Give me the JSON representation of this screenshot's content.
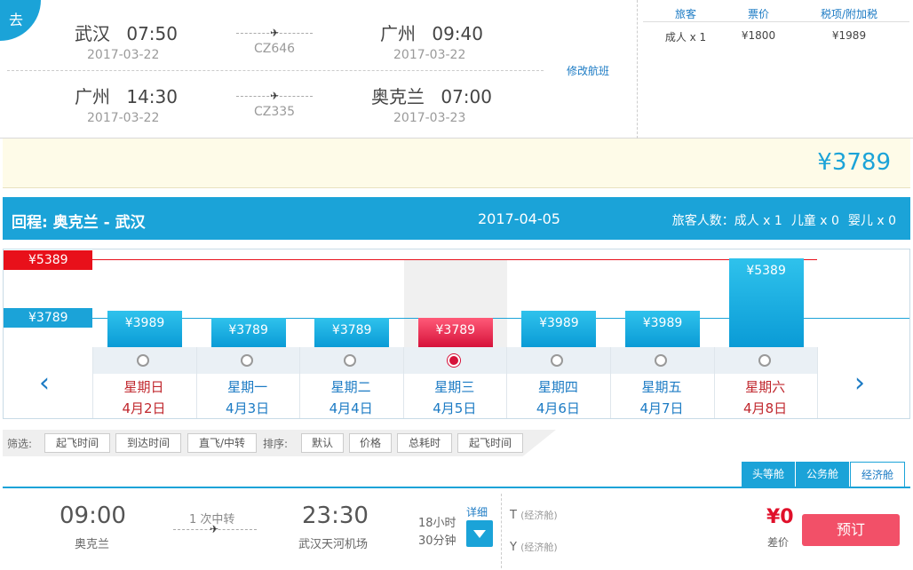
{
  "outbound": {
    "badge": "去",
    "segments": [
      {
        "from_city": "武汉",
        "dep_time": "07:50",
        "dep_date": "2017-03-22",
        "flight_no": "CZ646",
        "to_city": "广州",
        "arr_time": "09:40",
        "arr_date": "2017-03-22"
      },
      {
        "from_city": "广州",
        "dep_time": "14:30",
        "dep_date": "2017-03-22",
        "flight_no": "CZ335",
        "to_city": "奥克兰",
        "arr_time": "07:00",
        "arr_date": "2017-03-23"
      }
    ],
    "modify_link": "修改航班",
    "price_table": {
      "headers": [
        "旅客",
        "票价",
        "税项/附加税"
      ],
      "row": [
        "成人 x 1",
        "¥1800",
        "¥1989"
      ]
    },
    "total": "¥3789"
  },
  "return": {
    "label": "回程:  奥克兰 - 武汉",
    "date": "2017-04-05",
    "pax_label": "旅客人数：成人 x 1",
    "child": "儿童 x 0",
    "infant": "婴儿 x 0"
  },
  "calendar": {
    "ref_high_label": "¥5389",
    "ref_low_label": "¥3789",
    "ref_high_value": 5389,
    "ref_low_value": 3789,
    "days": [
      {
        "label": "¥3989",
        "price": 3989,
        "weekday": "星期日",
        "date": "4月2日",
        "weekend": true,
        "selected": false
      },
      {
        "label": "¥3789",
        "price": 3789,
        "weekday": "星期一",
        "date": "4月3日",
        "weekend": false,
        "selected": false
      },
      {
        "label": "¥3789",
        "price": 3789,
        "weekday": "星期二",
        "date": "4月4日",
        "weekend": false,
        "selected": false
      },
      {
        "label": "¥3789",
        "price": 3789,
        "weekday": "星期三",
        "date": "4月5日",
        "weekend": false,
        "selected": true
      },
      {
        "label": "¥3989",
        "price": 3989,
        "weekday": "星期四",
        "date": "4月6日",
        "weekend": false,
        "selected": false
      },
      {
        "label": "¥3989",
        "price": 3989,
        "weekday": "星期五",
        "date": "4月7日",
        "weekend": false,
        "selected": false
      },
      {
        "label": "¥5389",
        "price": 5389,
        "weekday": "星期六",
        "date": "4月8日",
        "weekend": true,
        "selected": false
      }
    ],
    "colors": {
      "bar": "#0fa4da",
      "selected": "#d6123a",
      "high_ref": "#e8101a",
      "low_ref": "#1ba3d8"
    }
  },
  "filter": {
    "label": "筛选:",
    "filter_buttons": [
      "起飞时间",
      "到达时间",
      "直飞/中转"
    ],
    "sort_label": "排序:",
    "sort_buttons": [
      "默认",
      "价格",
      "总耗时",
      "起飞时间"
    ]
  },
  "cabin_tabs": [
    "头等舱",
    "公务舱",
    "经济舱"
  ],
  "flight": {
    "dep_time": "09:00",
    "dep_city": "奥克兰",
    "transfer": "1 次中转",
    "arr_time": "23:30",
    "arr_airport": "武汉天河机场",
    "duration_h": "18小时",
    "duration_m": "30分钟",
    "detail": "详细",
    "fare1": "T",
    "fare1_class": "(经济舱)",
    "fare2": "Y",
    "fare2_class": "(经济舱)",
    "diff": "¥0",
    "diff_label": "差价",
    "book": "预订"
  }
}
